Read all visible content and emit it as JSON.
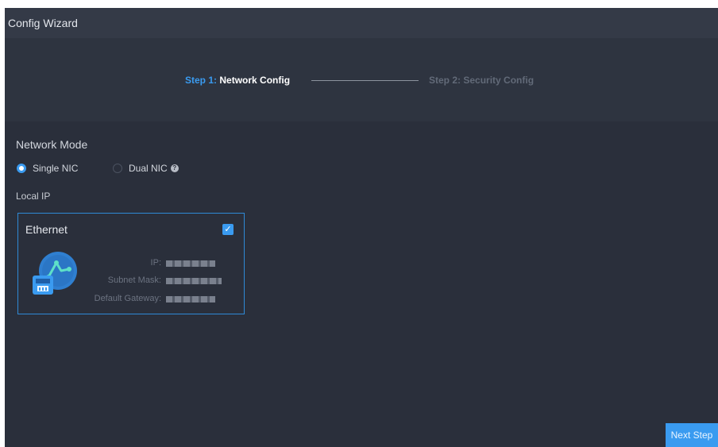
{
  "window": {
    "title": "Config Wizard"
  },
  "steps": [
    {
      "number": "Step 1:",
      "name": "Network Config",
      "state": "active"
    },
    {
      "number": "Step 2:",
      "name": "Security Config",
      "state": "pending"
    }
  ],
  "network_mode": {
    "label": "Network Mode",
    "options": [
      {
        "label": "Single NIC",
        "selected": true
      },
      {
        "label": "Dual NIC",
        "selected": false,
        "icon": "help-icon"
      }
    ]
  },
  "local_ip": {
    "label": "Local IP",
    "card": {
      "title": "Ethernet",
      "checked": true,
      "icon": "ethernet-icon",
      "fields": [
        {
          "label": "IP:"
        },
        {
          "label": "Subnet Mask:"
        },
        {
          "label": "Default Gateway:"
        }
      ]
    }
  },
  "footer": {
    "next_label": "Next Step"
  },
  "colors": {
    "accent": "#3a9bf0",
    "background": "#2a2f3b",
    "titlebar": "#343a47"
  }
}
